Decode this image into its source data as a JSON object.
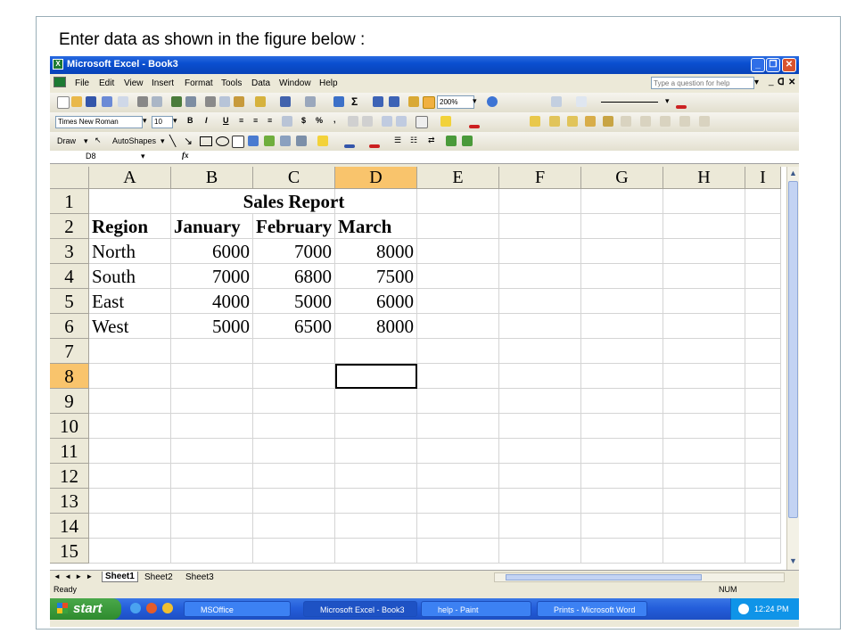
{
  "caption": "Enter data as shown in the figure below :",
  "window": {
    "title": "Microsoft Excel - Book3",
    "app_icon": "excel-icon"
  },
  "menu": {
    "items": [
      "File",
      "Edit",
      "View",
      "Insert",
      "Format",
      "Tools",
      "Data",
      "Window",
      "Help"
    ],
    "help_placeholder": "Type a question for help"
  },
  "toolbar": {
    "zoom": "200%"
  },
  "format_toolbar": {
    "font": "Times New Roman",
    "size": "10",
    "bold": "B",
    "italic": "I",
    "underline": "U",
    "currency": "$",
    "percent": "%",
    "comma": ","
  },
  "drawing_toolbar": {
    "draw": "Draw",
    "autoshapes": "AutoShapes"
  },
  "formula_bar": {
    "name_box": "D8",
    "fx": "fx",
    "content": ""
  },
  "sheet": {
    "columns": [
      "A",
      "B",
      "C",
      "D",
      "E",
      "F",
      "G",
      "H",
      "I"
    ],
    "selected_column": "D",
    "selected_row": "8",
    "rows": [
      {
        "n": "1",
        "cells": [
          "",
          "Sales Report",
          "",
          "",
          "",
          "",
          "",
          "",
          ""
        ]
      },
      {
        "n": "2",
        "cells": [
          "Region",
          "January",
          "February",
          "March",
          "",
          "",
          "",
          "",
          ""
        ]
      },
      {
        "n": "3",
        "cells": [
          "North",
          "6000",
          "7000",
          "8000",
          "",
          "",
          "",
          "",
          ""
        ]
      },
      {
        "n": "4",
        "cells": [
          "South",
          "7000",
          "6800",
          "7500",
          "",
          "",
          "",
          "",
          ""
        ]
      },
      {
        "n": "5",
        "cells": [
          "East",
          "4000",
          "5000",
          "6000",
          "",
          "",
          "",
          "",
          ""
        ]
      },
      {
        "n": "6",
        "cells": [
          "West",
          "5000",
          "6500",
          "8000",
          "",
          "",
          "",
          "",
          ""
        ]
      },
      {
        "n": "7",
        "cells": [
          "",
          "",
          "",
          "",
          "",
          "",
          "",
          "",
          ""
        ]
      },
      {
        "n": "8",
        "cells": [
          "",
          "",
          "",
          "",
          "",
          "",
          "",
          "",
          ""
        ]
      },
      {
        "n": "9",
        "cells": [
          "",
          "",
          "",
          "",
          "",
          "",
          "",
          "",
          ""
        ]
      },
      {
        "n": "10",
        "cells": [
          "",
          "",
          "",
          "",
          "",
          "",
          "",
          "",
          ""
        ]
      },
      {
        "n": "11",
        "cells": [
          "",
          "",
          "",
          "",
          "",
          "",
          "",
          "",
          ""
        ]
      },
      {
        "n": "12",
        "cells": [
          "",
          "",
          "",
          "",
          "",
          "",
          "",
          "",
          ""
        ]
      },
      {
        "n": "13",
        "cells": [
          "",
          "",
          "",
          "",
          "",
          "",
          "",
          "",
          ""
        ]
      },
      {
        "n": "14",
        "cells": [
          "",
          "",
          "",
          "",
          "",
          "",
          "",
          "",
          ""
        ]
      },
      {
        "n": "15",
        "cells": [
          "",
          "",
          "",
          "",
          "",
          "",
          "",
          "",
          ""
        ]
      }
    ]
  },
  "tabs": {
    "nav": "◄ ◄ ► ►",
    "items": [
      "Sheet1",
      "Sheet2",
      "Sheet3"
    ],
    "active": "Sheet1"
  },
  "status": {
    "left": "Ready",
    "num": "NUM"
  },
  "taskbar": {
    "start": "start",
    "tasks": [
      "MSOffice",
      "Microsoft Excel - Book3",
      "help - Paint",
      "Prints - Microsoft Word"
    ],
    "clock": "12:24 PM"
  },
  "colors": {
    "title_blue": "#0a4fd0",
    "selection_orange": "#f9c46c",
    "taskbar_blue": "#245edb",
    "start_green": "#2e8b2e"
  }
}
